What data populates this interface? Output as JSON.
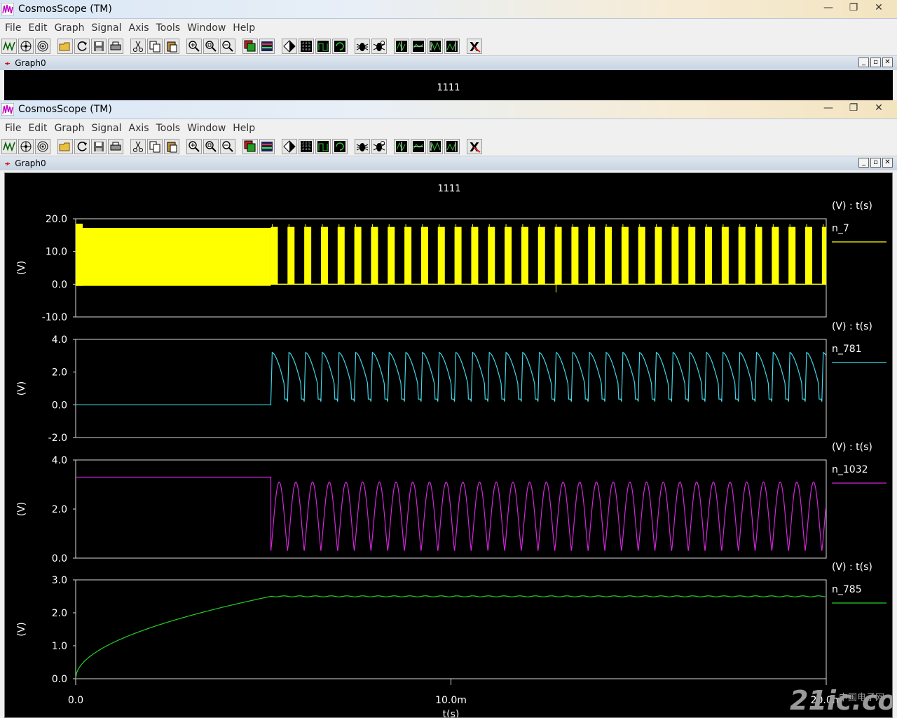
{
  "window": {
    "title": "CosmosScope (TM)",
    "controls": {
      "minimize": "—",
      "maximize": "❐",
      "close": "✕"
    }
  },
  "menus": [
    "File",
    "Edit",
    "Graph",
    "Signal",
    "Axis",
    "Tools",
    "Window",
    "Help"
  ],
  "toolbar_icons": [
    "waveform-icon",
    "nodes-icon",
    "target-icon",
    "open-folder-icon",
    "reload-icon",
    "save-icon",
    "print-icon",
    "cut-icon",
    "copy-icon",
    "paste-icon",
    "zoom-in-icon",
    "zoom-fit-icon",
    "zoom-out-icon",
    "stack-icon",
    "bus-icon",
    "marker-icon",
    "grid-icon",
    "axis-icon",
    "refresh-icon",
    "bug-icon",
    "bug-settings-icon",
    "measure1-icon",
    "measure2-icon",
    "measure3-icon",
    "measure4-icon",
    "delete-x-icon"
  ],
  "graph": {
    "window_title": "Graph0",
    "sub_controls": {
      "minimize": "_",
      "restore": "▫",
      "close": "✕"
    },
    "title": "1111",
    "xlabel": "t(s)",
    "x_ticks": [
      "0.0",
      "10.0m",
      "20.0m"
    ]
  },
  "watermark": {
    "text": "21ic.com",
    "subtext": "中国电子网"
  },
  "colors": {
    "yellow": "#ffff00",
    "cyan": "#3ed6e8",
    "magenta": "#d028d8",
    "green": "#25d025"
  },
  "chart_data": [
    {
      "type": "line",
      "series": [
        {
          "name": "n_7",
          "description": "dense switching bursts"
        }
      ],
      "unit_label": "(V) : t(s)",
      "ylabel": "(V)",
      "yticks": [
        "20.0",
        "10.0",
        "0.0",
        "-10.0"
      ],
      "ylim": [
        -10,
        20
      ],
      "xlim": [
        0,
        0.02
      ]
    },
    {
      "type": "line",
      "series": [
        {
          "name": "n_781"
        }
      ],
      "unit_label": "(V) : t(s)",
      "ylabel": "(V)",
      "yticks": [
        "4.0",
        "2.0",
        "0.0",
        "-2.0"
      ],
      "ylim": [
        -2,
        4
      ],
      "xlim": [
        0,
        0.02
      ],
      "flat_until": 0.0052,
      "low": 0.2,
      "high": 3.2
    },
    {
      "type": "line",
      "series": [
        {
          "name": "n_1032"
        }
      ],
      "unit_label": "(V) : t(s)",
      "ylabel": "(V)",
      "yticks": [
        "4.0",
        "2.0",
        "0.0"
      ],
      "ylim": [
        0,
        4
      ],
      "xlim": [
        0,
        0.02
      ],
      "flat_until": 0.0052,
      "initial": 3.3,
      "low": 0.3,
      "high": 3.1
    },
    {
      "type": "line",
      "series": [
        {
          "name": "n_785"
        }
      ],
      "unit_label": "(V) : t(s)",
      "ylabel": "(V)",
      "yticks": [
        "3.0",
        "2.0",
        "1.0",
        "0.0"
      ],
      "ylim": [
        0,
        3
      ],
      "xlim": [
        0,
        0.02
      ],
      "rise_until": 0.0052,
      "final": 2.5
    }
  ]
}
